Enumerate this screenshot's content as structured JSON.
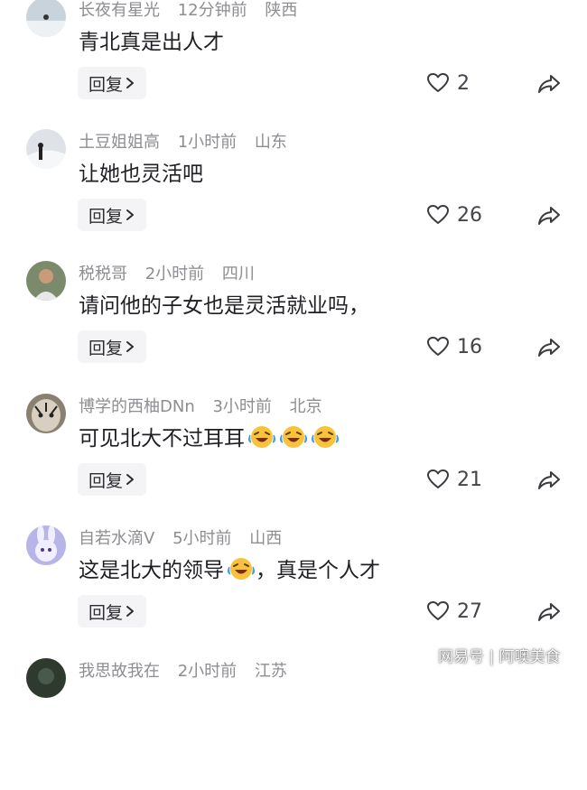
{
  "comments": [
    {
      "username": "长夜有星光",
      "time": "12分钟前",
      "location": "陕西",
      "text": "青北真是出人才",
      "reply_label": "回复",
      "likes": "2"
    },
    {
      "username": "土豆姐姐高",
      "time": "1小时前",
      "location": "山东",
      "text": "让她也灵活吧",
      "reply_label": "回复",
      "likes": "26"
    },
    {
      "username": "税税哥",
      "time": "2小时前",
      "location": "四川",
      "text": "请问他的子女也是灵活就业吗，",
      "reply_label": "回复",
      "likes": "16"
    },
    {
      "username": "博学的西柚DNn",
      "time": "3小时前",
      "location": "北京",
      "text": "可见北大不过耳耳",
      "reply_label": "回复",
      "likes": "21"
    },
    {
      "username": "自若水滴V",
      "time": "5小时前",
      "location": "山西",
      "text_before": "这是北大的领导",
      "text_after": "，真是个人才",
      "reply_label": "回复",
      "likes": "27"
    },
    {
      "username": "我思故我在",
      "time": "2小时前",
      "location": "江苏"
    }
  ],
  "watermark": "网易号 | 阿噢美食",
  "icons": {
    "like": "heart-outline-icon",
    "share": "share-arrow-icon",
    "reply": "chevron-right-icon",
    "emoji": "laughing-tears-emoji"
  }
}
